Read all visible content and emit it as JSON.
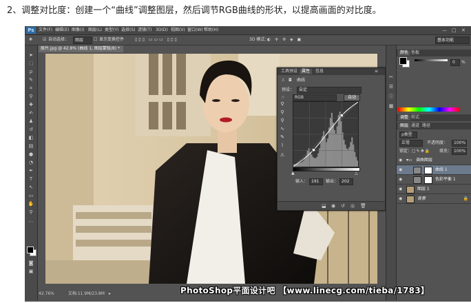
{
  "instruction": "2、调整对比度：创建一个“曲线”调整图层，然后调节RGB曲线的形状，以提高画面的对比度。",
  "app": {
    "logo": "Ps",
    "menu": [
      "文件(F)",
      "编辑(E)",
      "图像(I)",
      "图层(L)",
      "类型(Y)",
      "选择(S)",
      "滤镜(T)",
      "3D(D)",
      "视图(V)",
      "窗口(W)",
      "帮助(H)"
    ],
    "window_controls": [
      "—",
      "□",
      "✕"
    ]
  },
  "options_bar": {
    "auto_select_label": "自动选择：",
    "auto_select_value": "图层",
    "show_transform": "显示变换控件",
    "mode_3d": "3D 模式：",
    "workspace": "基本功能"
  },
  "document": {
    "tab": "原片.jpg @ 42.8% (曲线 1, 图层蒙版/8) *",
    "zoom": "42.76%",
    "doc_info": "文档:11.9M/23.8M"
  },
  "properties_panel": {
    "tabs": [
      "工具预设",
      "属性",
      "信息"
    ],
    "title": "曲线",
    "preset_label": "预设：",
    "preset_value": "自定",
    "channel": "RGB",
    "auto_button": "自动",
    "input_label": "输入：",
    "input_value": "191",
    "output_label": "输出：",
    "output_value": "202",
    "curve_points": [
      [
        0,
        0
      ],
      [
        80,
        66
      ],
      [
        191,
        202
      ],
      [
        255,
        255
      ]
    ],
    "histogram": [
      4,
      4,
      5,
      5,
      6,
      7,
      8,
      10,
      14,
      18,
      26,
      30,
      24,
      20,
      16,
      14,
      14,
      16,
      22,
      30,
      40,
      50,
      58,
      48,
      40,
      46,
      64,
      80,
      88,
      72,
      60,
      54,
      66,
      84,
      90,
      74,
      56,
      44,
      36,
      30,
      28,
      32,
      40,
      48,
      36,
      24,
      16,
      10
    ]
  },
  "color_panel": {
    "tabs": [
      "颜色",
      "色板"
    ],
    "k_value": "0",
    "k_unit": "%"
  },
  "adjust_panel": {
    "tabs": [
      "调整",
      "样式"
    ]
  },
  "layers_panel": {
    "tabs": [
      "图层",
      "通道",
      "路径"
    ],
    "kind_label": "ρ类型",
    "blend_mode": "正常",
    "opacity_label": "不透明度：",
    "opacity_value": "100%",
    "lock_label": "锁定：",
    "fill_label": "填充：",
    "fill_value": "100%",
    "layers": [
      {
        "name": "调曲图层",
        "type": "group"
      },
      {
        "name": "曲线 1",
        "type": "adjustment"
      },
      {
        "name": "色彩平衡 1",
        "type": "adjustment"
      },
      {
        "name": "图层 1",
        "type": "pixel"
      },
      {
        "name": "背景",
        "type": "background"
      }
    ]
  },
  "watermark": "PhotoShop平面设计吧 【www.linecg.com/tieba/1783】",
  "colors": {
    "ps_bg": "#535353",
    "panel_dark": "#3d3d3d",
    "selected_layer": "#6c7a8c"
  }
}
